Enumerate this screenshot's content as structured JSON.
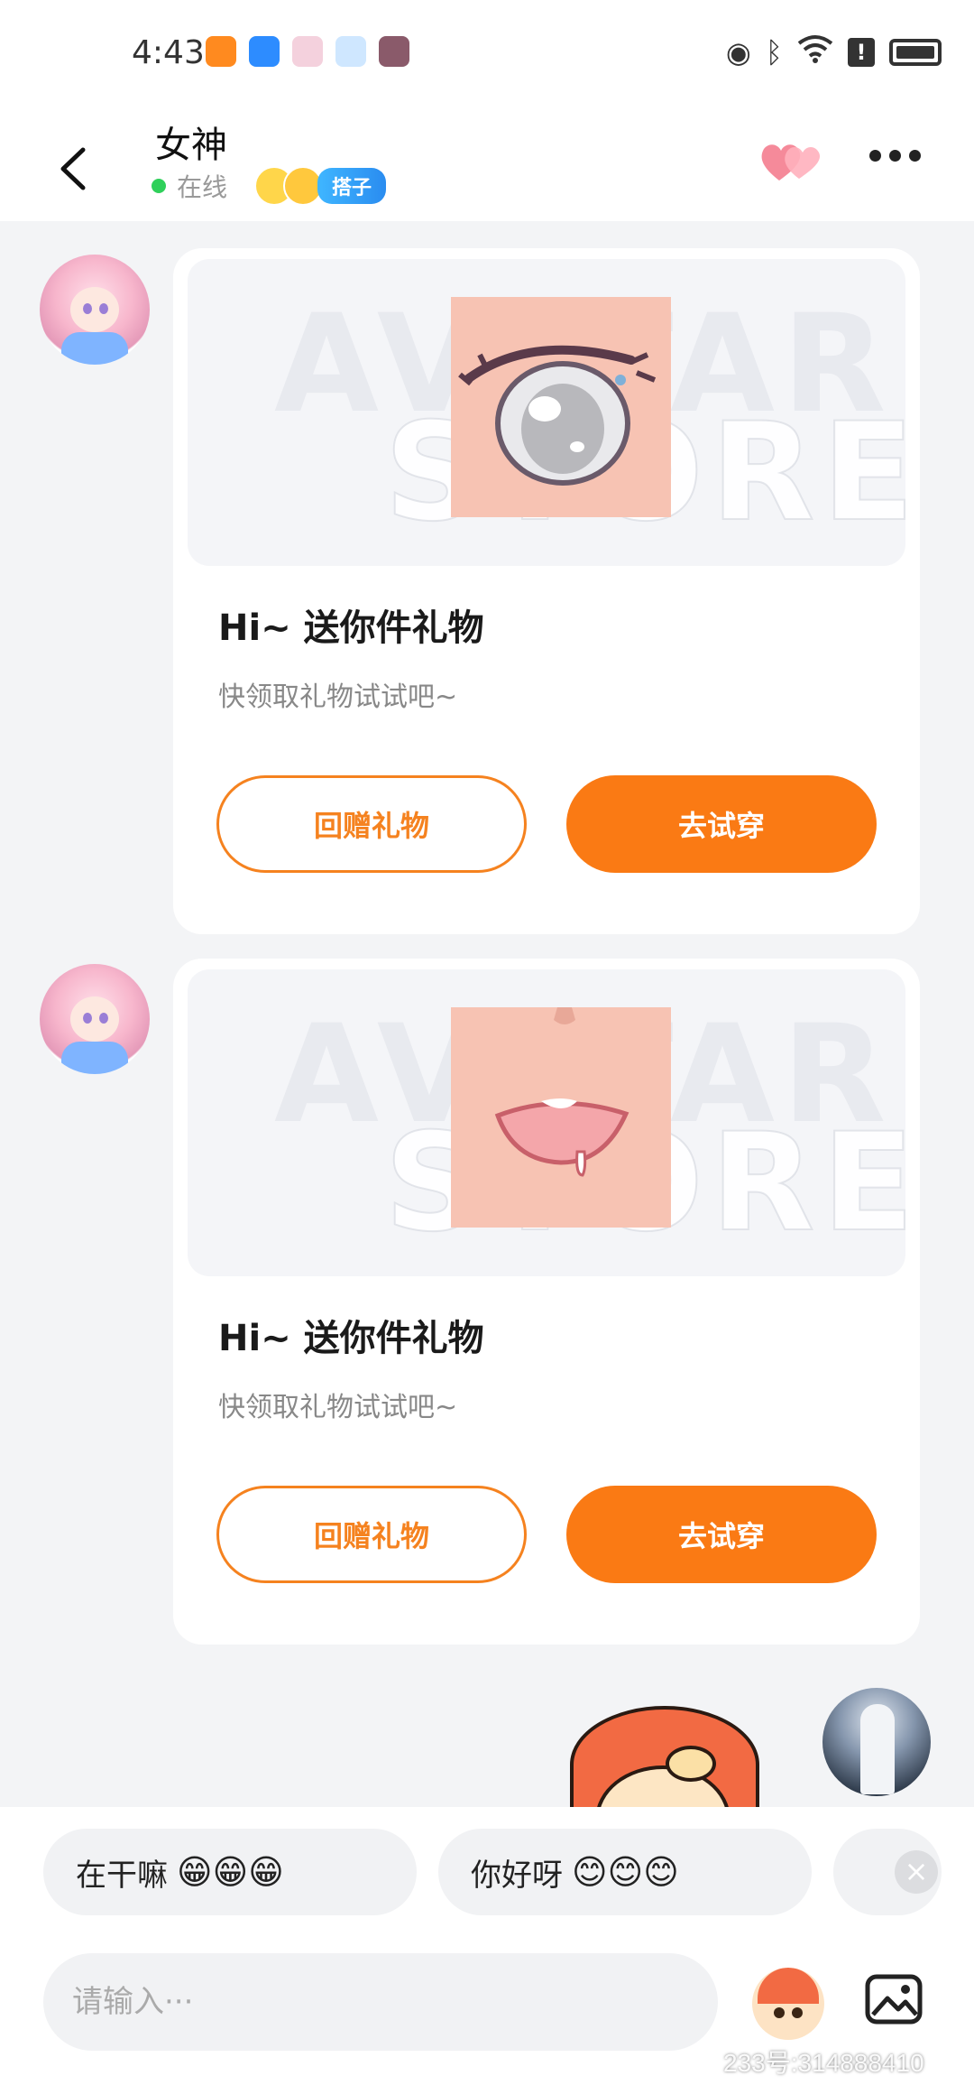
{
  "status_bar": {
    "time": "4:43",
    "app_icons": [
      "video-app-icon",
      "weather-app-icon",
      "browser-app-icon",
      "qq-app-icon",
      "game-app-icon"
    ],
    "right_icons": [
      "eye-icon",
      "bluetooth-icon",
      "wifi-icon",
      "alert-icon",
      "battery-icon"
    ]
  },
  "header": {
    "contact_name": "女神",
    "online_status": "在线",
    "tag_label": "搭子"
  },
  "messages": [
    {
      "title": "Hi~ 送你件礼物",
      "subtitle": "快领取礼物试试吧~",
      "secondary_button": "回赠礼物",
      "primary_button": "去试穿",
      "preview_watermark_line1": "AVATAR",
      "preview_watermark_line2": "STORE",
      "preview_color": "#f7c3b3"
    },
    {
      "title": "Hi~ 送你件礼物",
      "subtitle": "快领取礼物试试吧~",
      "secondary_button": "回赠礼物",
      "primary_button": "去试穿",
      "preview_watermark_line1": "AVATAR",
      "preview_watermark_line2": "STORE",
      "preview_color": "#f7c3b3"
    }
  ],
  "quick_replies": [
    {
      "text": "在干嘛",
      "emojis": "😁😁😁"
    },
    {
      "text": "你好呀",
      "emojis": "😊😊😊"
    }
  ],
  "input": {
    "placeholder": "请输入···"
  },
  "footer_watermark": "233号:314888410",
  "colors": {
    "accent": "#fa7a14",
    "online": "#2fd05a",
    "background": "#f3f4f6"
  }
}
